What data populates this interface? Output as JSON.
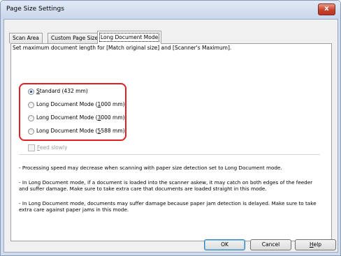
{
  "window": {
    "title": "Page Size Settings",
    "close_label": "x"
  },
  "tabs": [
    {
      "label": "Scan Area",
      "active": false
    },
    {
      "label": "Custom Page Size",
      "active": false
    },
    {
      "label": "Long Document Mode",
      "active": true
    }
  ],
  "panel": {
    "description": "Set maximum document length for [Match original size] and [Scanner's Maximum].",
    "options": [
      {
        "pre": "",
        "key": "S",
        "post": "tandard (432 mm)",
        "selected": true
      },
      {
        "pre": "Long Document Mode (",
        "key": "1",
        "post": "000 mm)",
        "selected": false
      },
      {
        "pre": "Long Document Mode (",
        "key": "3",
        "post": "000 mm)",
        "selected": false
      },
      {
        "pre": "Long Document Mode (",
        "key": "5",
        "post": "588 mm)",
        "selected": false
      }
    ],
    "feed_slowly": {
      "key": "F",
      "post": "eed slowly",
      "checked": false,
      "enabled": false
    },
    "notes": [
      "- Processing speed may decrease when scanning with paper size detection set to Long Document mode.",
      "- In Long Document mode, if a document is loaded into the scanner askew, it may catch on both edges of the feeder and suffer damage. Make sure to take extra care that documents are loaded straight in this mode.",
      "- In Long Document mode, documents may suffer damage because paper jam detection is delayed. Make sure to take extra care against paper jams in this mode."
    ]
  },
  "buttons": {
    "ok": "OK",
    "cancel": "Cancel",
    "help_key": "H",
    "help_post": "elp"
  },
  "colors": {
    "highlight": "#e02020",
    "selected_radio": "#1c4ea8"
  }
}
